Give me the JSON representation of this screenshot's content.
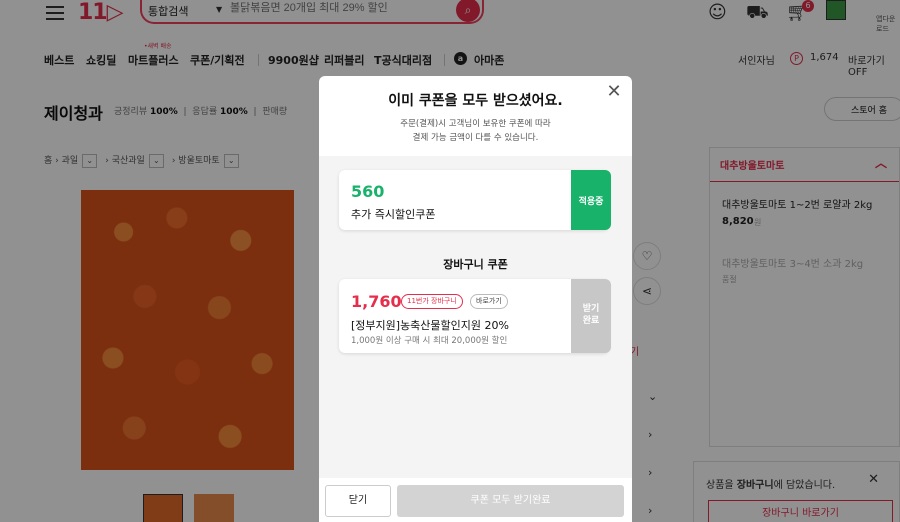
{
  "header": {
    "logo": "11",
    "search_scope": "통합검색",
    "search_placeholder": "볼닭볶음면 20개입 최대 29% 할인",
    "cart_count": "6",
    "apple_label": "앱다운로드"
  },
  "gnb": {
    "items": [
      "베스트",
      "쇼킹딜",
      "마트플러스",
      "쿠폰/기획전",
      "9900원샵",
      "리퍼블리",
      "T공식대리점",
      "아마존"
    ],
    "mart_tag": "•새벽 배송",
    "user_name": "서인자님",
    "points": "1,674",
    "shortcut": "바로가기 OFF"
  },
  "store": {
    "name": "제이청과",
    "review_label": "긍정리뷰",
    "review_value": "100%",
    "response_label": "응답률",
    "response_value": "100%",
    "sales_label": "판매량",
    "home_button": "스토어 홈"
  },
  "breadcrumb": [
    "홈",
    "과일",
    "국산과일",
    "방울토마토"
  ],
  "right_panel": {
    "header": "대추방울토마토",
    "option1_name": "대추방울토마토 1~2번 로얄과 2kg",
    "option1_price": "8,820",
    "option1_unit": "원",
    "option2_name": "대추방울토마토 3~4번 소과 2kg",
    "option2_status": "품절"
  },
  "toast": {
    "prefix": "상품을 ",
    "bold": "장바구니",
    "suffix": "에 담았습니다.",
    "button": "장바구니 바로가기"
  },
  "modal": {
    "title": "이미 쿠폰을 모두 받으셨어요.",
    "subtitle_line1": "주문(결제)시 고객님이 보유한 쿠폰에 따라",
    "subtitle_line2": "결제 가능 금액이 다를 수 있습니다.",
    "coupon1": {
      "amount": "560",
      "name": "추가 즉시할인쿠폰",
      "stub": "적용중"
    },
    "cart_section_title": "장바구니 쿠폰",
    "coupon2": {
      "amount": "1,760",
      "chip1": "11번가 장바구니",
      "chip2": "바로가기",
      "name": "[정부지원]농축산물할인지원 20%",
      "condition": "1,000원 이상 구매 시 최대 20,000원 할인",
      "stub_line1": "받기",
      "stub_line2": "완료"
    },
    "close_button": "닫기",
    "receive_all_button": "쿠폰 모두 받기완료"
  },
  "colors": {
    "brand": "#e52d4c",
    "applied_green": "#19b26b",
    "coupon1_amount": "#19b26b",
    "coupon2_amount": "#e52d4c"
  }
}
